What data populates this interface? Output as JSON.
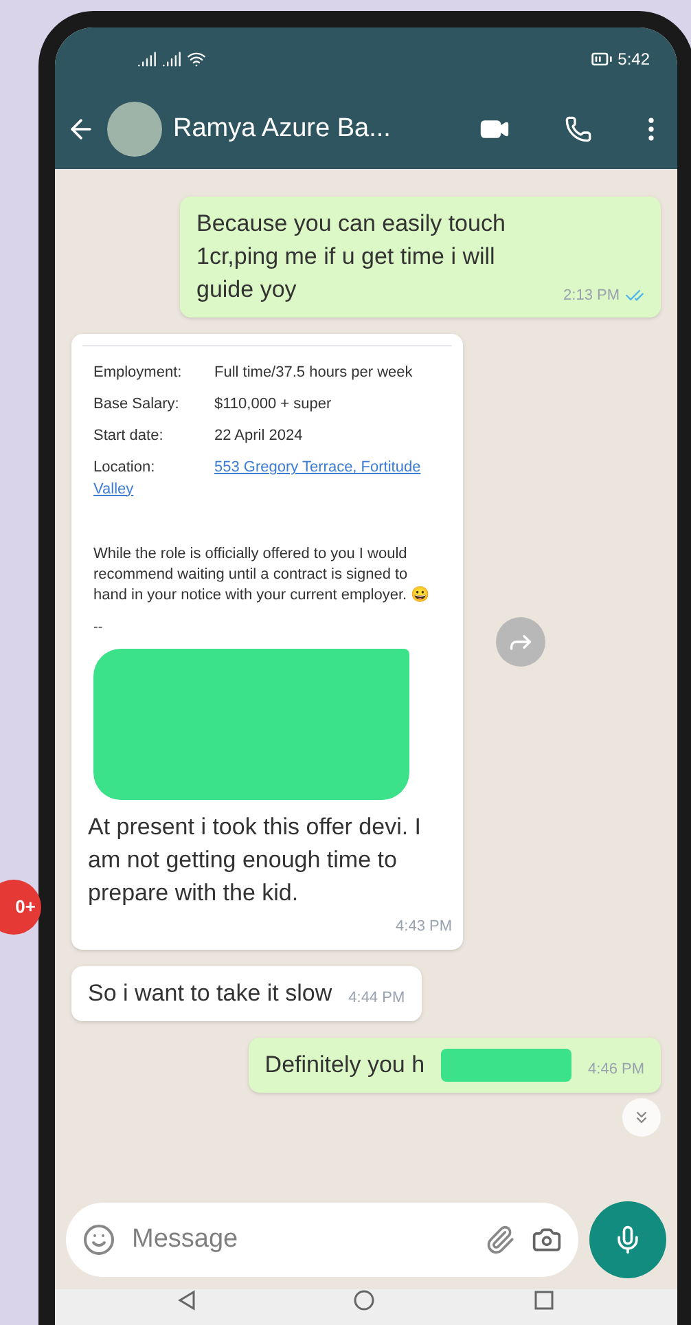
{
  "status_bar": {
    "time": "5:42"
  },
  "header": {
    "contact": "Ramya Azure Ba..."
  },
  "messages": [
    {
      "kind": "text",
      "outgoing": true,
      "text": "Because you can easily touch 1cr,ping me if u get time i will guide yoy",
      "time": "2:13 PM",
      "read": true,
      "redacted": false
    },
    {
      "kind": "offer",
      "outgoing": false,
      "fields": [
        {
          "label": "Employment:",
          "value": "Full time/37.5 hours per week",
          "link": false
        },
        {
          "label": "Base Salary:",
          "value": "$110,000 + super",
          "link": false
        },
        {
          "label": "Start date:",
          "value": "22 April 2024",
          "link": false
        },
        {
          "label": "Location:",
          "value": "553 Gregory Terrace, Fortitude Valley",
          "link": true
        }
      ],
      "note": "While the role is officially offered to you I would recommend waiting until a contract is signed to hand in your notice with your current employer. 😀",
      "separator": "--",
      "text": "At present i took this offer devi. I am not getting enough time to prepare with the kid.",
      "time": "4:43 PM"
    },
    {
      "kind": "text",
      "outgoing": false,
      "text": "So i  want to take it slow",
      "time": "4:44 PM"
    },
    {
      "kind": "text",
      "outgoing": true,
      "text": "Definitely you h",
      "time": "4:46 PM",
      "read": false,
      "redacted": true
    }
  ],
  "composer": {
    "placeholder": "Message"
  },
  "side_badge": "0+"
}
